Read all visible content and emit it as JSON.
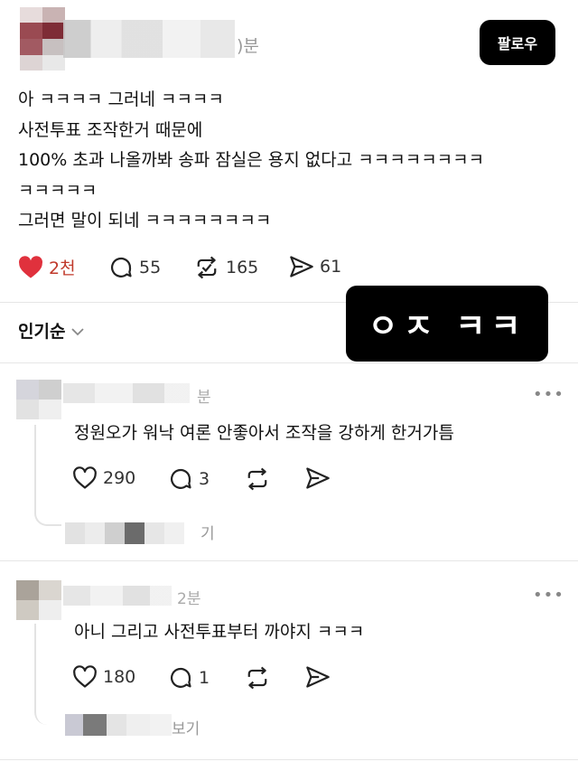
{
  "post": {
    "time_suffix": ")분",
    "follow_label": "팔로우",
    "lines": [
      "아 ㅋㅋㅋㅋ 그러네 ㅋㅋㅋㅋ",
      "사전투표 조작한거 때문에",
      "100% 초과 나올까봐 송파 잠실은 용지 없다고 ㅋㅋㅋㅋㅋㅋㅋㅋ",
      "ㅋㅋㅋㅋㅋ",
      "그러면 말이 되네 ㅋㅋㅋㅋㅋㅋㅋㅋ"
    ],
    "likes": "2천",
    "comments": "55",
    "reposts": "165",
    "shares": "61"
  },
  "sort": {
    "label": "인기순"
  },
  "overlay": {
    "text": "ㅇㅈ ㅋㅋ"
  },
  "comments": [
    {
      "time": "분",
      "text": "정원오가 워낙 여론 안좋아서 조작을 강하게 한거가틈",
      "likes": "290",
      "replies": "3",
      "view_replies": "기"
    },
    {
      "time": "2분",
      "text": "아니 그리고 사전투표부터 까야지 ㅋㅋㅋ",
      "likes": "180",
      "replies": "1",
      "view_replies": "보기"
    }
  ],
  "icons": {
    "more": "more-dots-icon",
    "heart": "heart-icon",
    "comment": "comment-bubble-icon",
    "repost": "repost-icon",
    "share": "share-send-icon",
    "chevron": "chevron-down-icon"
  },
  "colors": {
    "like_active": "#e0313d",
    "text": "#111111",
    "muted": "#999999",
    "follow_bg": "#000000"
  }
}
